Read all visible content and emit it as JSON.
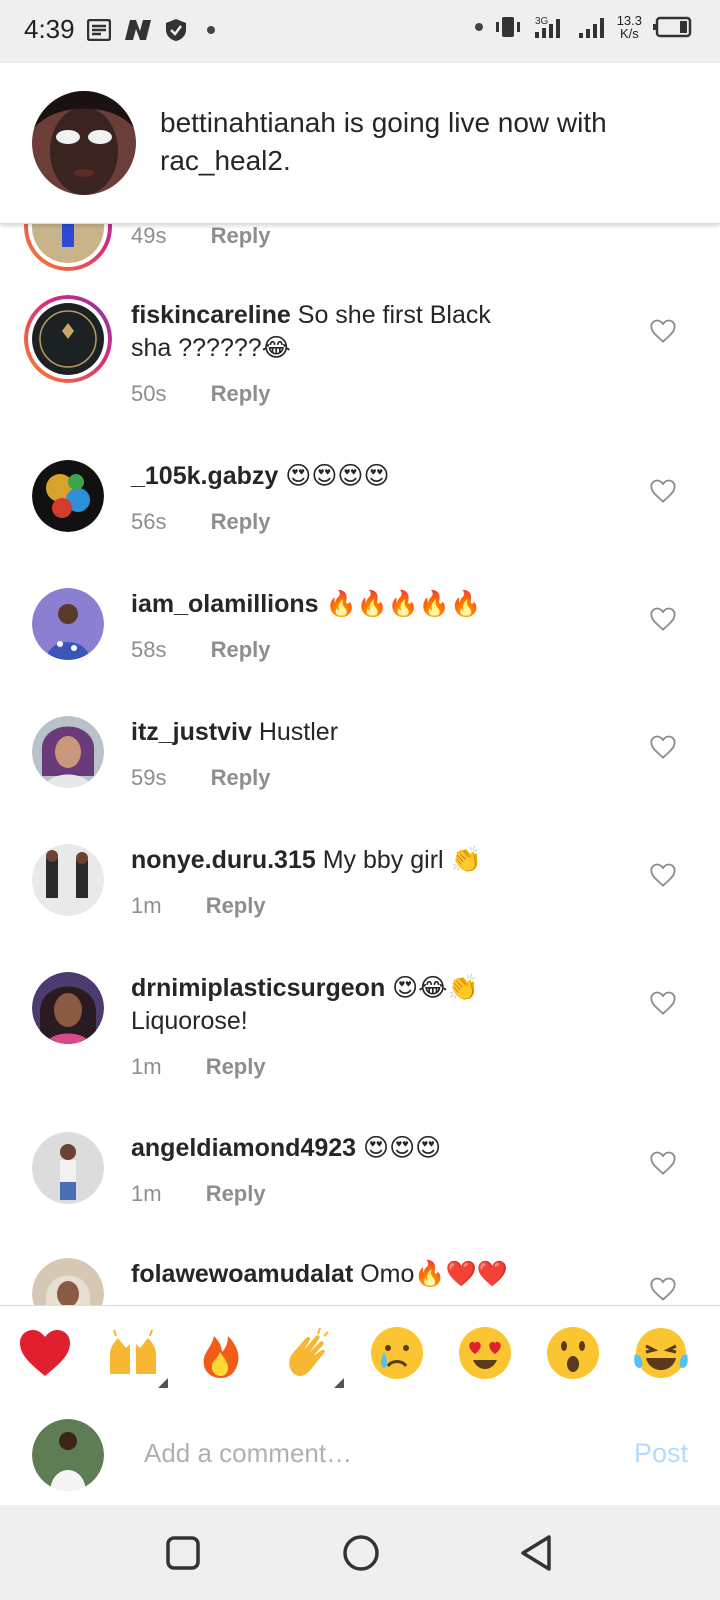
{
  "status_bar": {
    "time": "4:39",
    "network_speed_value": "13.3",
    "network_speed_unit": "K/s",
    "icons": [
      "notes-icon",
      "n-app-icon",
      "shield-icon",
      "dot-icon",
      "vibrate-icon",
      "signal-icon",
      "signal-icon",
      "battery-icon"
    ]
  },
  "banner": {
    "text": "bettinahtianah is going live now with rac_heal2."
  },
  "comments": [
    {
      "username": "",
      "text": "",
      "time": "49s",
      "reply": "Reply"
    },
    {
      "username": "fiskincareline",
      "text": "So she first Black sha ??????😂",
      "time": "50s",
      "reply": "Reply"
    },
    {
      "username": "_105k.gabzy",
      "text": "😍😍😍😍",
      "time": "56s",
      "reply": "Reply"
    },
    {
      "username": "iam_olamillions",
      "text": "🔥🔥🔥🔥🔥",
      "time": "58s",
      "reply": "Reply"
    },
    {
      "username": "itz_justviv",
      "text": "Hustler",
      "time": "59s",
      "reply": "Reply"
    },
    {
      "username": "nonye.duru.315",
      "text": "My bby girl 👏",
      "time": "1m",
      "reply": "Reply"
    },
    {
      "username": "drnimiplasticsurgeon",
      "text": "😍😂👏 Liquorose!",
      "time": "1m",
      "reply": "Reply"
    },
    {
      "username": "angeldiamond4923",
      "text": "😍😍😍",
      "time": "1m",
      "reply": "Reply"
    },
    {
      "username": "folawewoamudalat",
      "text": "Omo🔥❤️❤️",
      "time": "",
      "reply": ""
    }
  ],
  "emoji_bar": [
    "❤️",
    "🙌",
    "🔥",
    "👏",
    "😢",
    "😍",
    "😮",
    "😂"
  ],
  "input": {
    "placeholder": "Add a comment…",
    "post_label": "Post"
  },
  "colors": {
    "post_disabled": "#b3dbff",
    "meta_gray": "#8e8e8e",
    "ring_gradient": [
      "#f58529",
      "#dd2a7b",
      "#8134af"
    ]
  },
  "nav_icons": [
    "square-recents-icon",
    "circle-home-icon",
    "triangle-back-icon"
  ]
}
